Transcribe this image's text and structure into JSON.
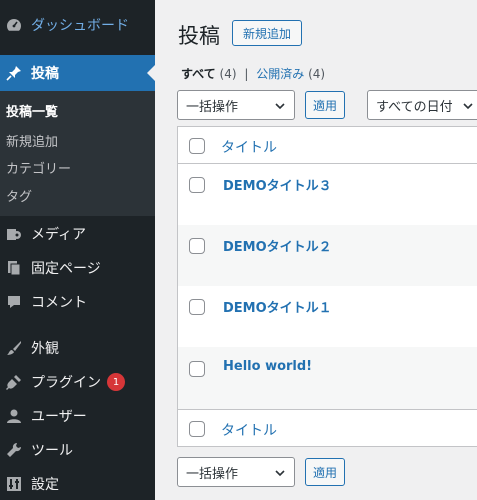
{
  "sidebar": {
    "dashboard": {
      "label": "ダッシュボード",
      "icon": "dashboard-icon"
    },
    "posts": {
      "label": "投稿",
      "icon": "pin-icon"
    },
    "posts_sub": [
      "投稿一覧",
      "新規追加",
      "カテゴリー",
      "タグ"
    ],
    "items": [
      {
        "label": "メディア",
        "icon": "media-icon"
      },
      {
        "label": "固定ページ",
        "icon": "page-icon"
      },
      {
        "label": "コメント",
        "icon": "comment-icon"
      },
      {
        "label": "外観",
        "icon": "brush-icon"
      },
      {
        "label": "プラグイン",
        "icon": "plugin-icon",
        "badge": "1"
      },
      {
        "label": "ユーザー",
        "icon": "user-icon"
      },
      {
        "label": "ツール",
        "icon": "wrench-icon"
      },
      {
        "label": "設定",
        "icon": "settings-icon"
      }
    ]
  },
  "main": {
    "title": "投稿",
    "add_new": "新規追加",
    "filters": {
      "all": "すべて",
      "all_count": "(4)",
      "separator": "|",
      "published": "公開済み",
      "published_count": "(4)"
    },
    "bulk_action": "一括操作",
    "apply": "適用",
    "date_filter": "すべての日付",
    "column_title": "タイトル",
    "posts": [
      "DEMOタイトル３",
      "DEMOタイトル２",
      "DEMOタイトル１",
      "Hello world!"
    ]
  },
  "colors": {
    "sidebar_bg": "#1d2327",
    "accent": "#2271b1",
    "badge": "#d63638"
  }
}
